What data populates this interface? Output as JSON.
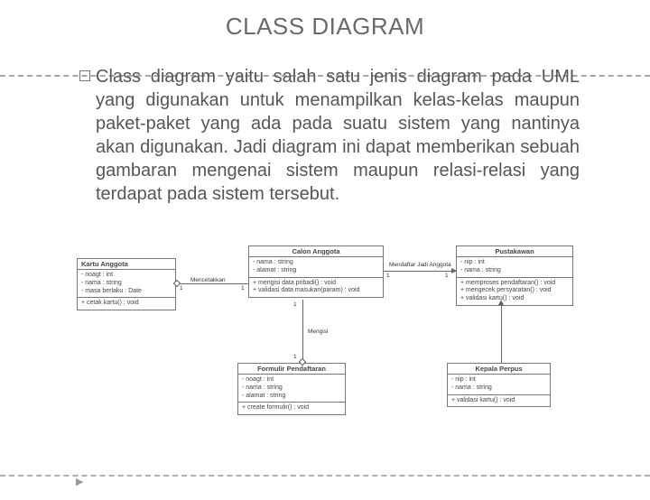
{
  "title": "CLASS DIAGRAM",
  "paragraph": "Class diagram yaitu salah satu jenis diagram pada UML yang digunakan untuk menampilkan kelas-kelas maupun paket-paket yang ada pada suatu sistem yang nantinya akan digunakan. Jadi diagram ini dapat memberikan sebuah gambaran mengenai sistem maupun relasi-relasi yang terdapat pada sistem tersebut.",
  "uml": {
    "kartu": {
      "title": "Kartu Anggota",
      "attrs": [
        "- noagt : int",
        "- nama : string",
        "- masa berlaku : Date"
      ],
      "ops": [
        "+ cetak kartu() : void"
      ]
    },
    "calon": {
      "title": "Calon Anggota",
      "attrs": [
        "- nama : string",
        "- alamat : string"
      ],
      "ops": [
        "+ mengisi data pribadi() : void",
        "+ validasi data masukan(param) : void"
      ]
    },
    "pustakawan": {
      "title": "Pustakawan",
      "attrs": [
        "- nip : int",
        "- nama : string"
      ],
      "ops": [
        "+ memproses pendaftaran() : void",
        "+ mengecek persyaratan() : void",
        "+ validasi kartu() : void"
      ]
    },
    "formulir": {
      "title": "Formulir Pendaftaran",
      "attrs": [
        "- noagt : int",
        "- nama : string",
        "- alamat : string"
      ],
      "ops": [
        "+ create formulir() : void"
      ]
    },
    "kepala": {
      "title": "Kepala Perpus",
      "attrs": [
        "- nip : int",
        "- nama : string"
      ],
      "ops": [
        "+ validasi kartu() : void"
      ]
    }
  },
  "labels": {
    "mencetakkan": "Mencetakkan",
    "mengisi": "Mengisi",
    "mendaftar": "Mendaftar Jadi Anggota"
  }
}
